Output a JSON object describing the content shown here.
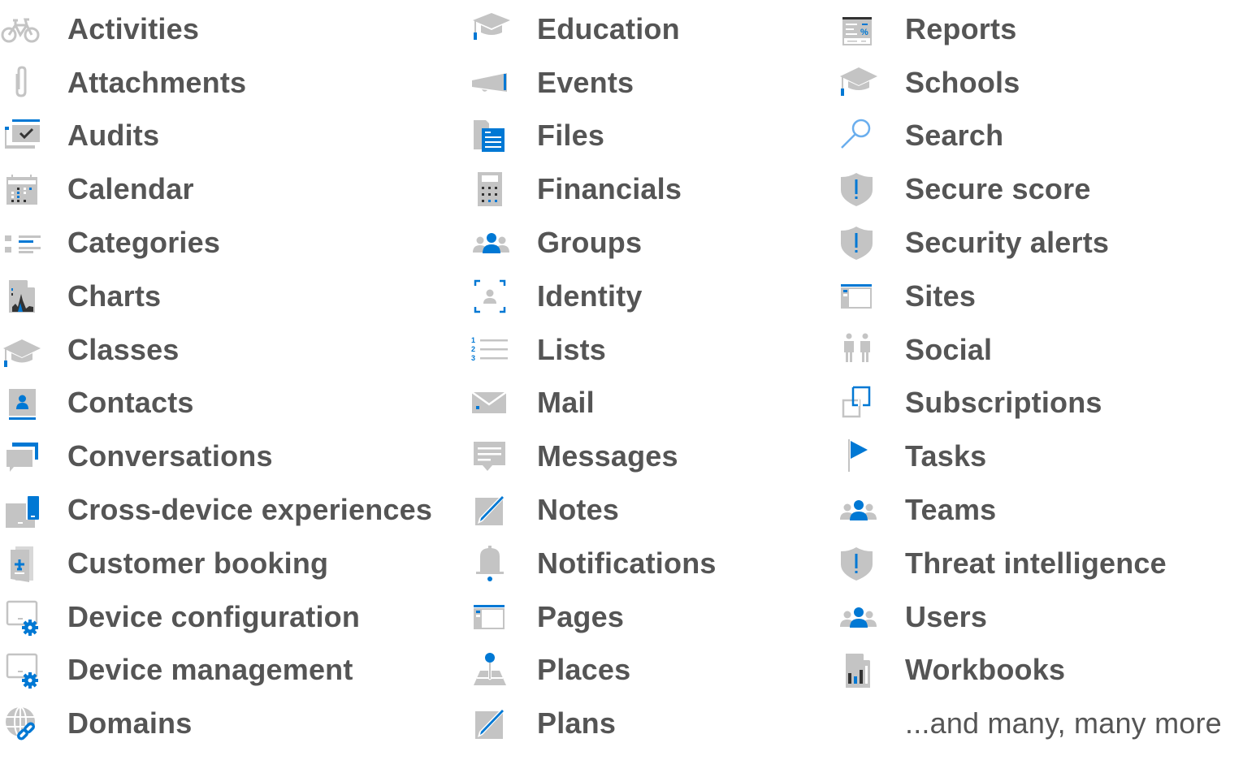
{
  "colors": {
    "text": "#555555",
    "icon_gray": "#c4c4c4",
    "icon_dark": "#333333",
    "accent_blue": "#0078d4"
  },
  "columns": [
    {
      "items": [
        {
          "label": "Activities",
          "icon": "bicycle-icon"
        },
        {
          "label": "Attachments",
          "icon": "paperclip-icon"
        },
        {
          "label": "Audits",
          "icon": "audit-checkmark-icon"
        },
        {
          "label": "Calendar",
          "icon": "calendar-icon"
        },
        {
          "label": "Categories",
          "icon": "categories-list-icon"
        },
        {
          "label": "Charts",
          "icon": "chart-document-icon"
        },
        {
          "label": "Classes",
          "icon": "graduation-cap-icon"
        },
        {
          "label": "Contacts",
          "icon": "contact-card-icon"
        },
        {
          "label": "Conversations",
          "icon": "chat-bubbles-icon"
        },
        {
          "label": "Cross-device experiences",
          "icon": "laptop-phone-icon"
        },
        {
          "label": "Customer booking",
          "icon": "passport-booking-icon"
        },
        {
          "label": "Device configuration",
          "icon": "device-gear-icon"
        },
        {
          "label": "Device management",
          "icon": "device-gear-icon"
        },
        {
          "label": "Domains",
          "icon": "globe-link-icon"
        }
      ]
    },
    {
      "items": [
        {
          "label": "Education",
          "icon": "graduation-cap-icon"
        },
        {
          "label": "Events",
          "icon": "megaphone-icon"
        },
        {
          "label": "Files",
          "icon": "files-icon"
        },
        {
          "label": "Financials",
          "icon": "calculator-icon"
        },
        {
          "label": "Groups",
          "icon": "group-people-icon"
        },
        {
          "label": "Identity",
          "icon": "identity-scan-icon"
        },
        {
          "label": "Lists",
          "icon": "numbered-list-icon"
        },
        {
          "label": "Mail",
          "icon": "mail-envelope-icon"
        },
        {
          "label": "Messages",
          "icon": "message-bubble-icon"
        },
        {
          "label": "Notes",
          "icon": "pen-note-icon"
        },
        {
          "label": "Notifications",
          "icon": "bell-icon"
        },
        {
          "label": "Pages",
          "icon": "browser-page-icon"
        },
        {
          "label": "Places",
          "icon": "map-pin-icon"
        },
        {
          "label": "Plans",
          "icon": "pen-note-icon"
        }
      ]
    },
    {
      "items": [
        {
          "label": "Reports",
          "icon": "report-document-icon"
        },
        {
          "label": "Schools",
          "icon": "graduation-cap-icon"
        },
        {
          "label": "Search",
          "icon": "magnifier-icon"
        },
        {
          "label": "Secure score",
          "icon": "shield-alert-icon"
        },
        {
          "label": "Security alerts",
          "icon": "shield-alert-icon"
        },
        {
          "label": "Sites",
          "icon": "browser-page-icon"
        },
        {
          "label": "Social",
          "icon": "two-people-icon"
        },
        {
          "label": "Subscriptions",
          "icon": "overlapping-squares-icon"
        },
        {
          "label": "Tasks",
          "icon": "flag-icon"
        },
        {
          "label": "Teams",
          "icon": "group-people-icon"
        },
        {
          "label": "Threat intelligence",
          "icon": "shield-alert-icon"
        },
        {
          "label": "Users",
          "icon": "group-people-icon"
        },
        {
          "label": "Workbooks",
          "icon": "workbook-chart-icon"
        }
      ]
    }
  ],
  "footer_text": "...and many, many more"
}
